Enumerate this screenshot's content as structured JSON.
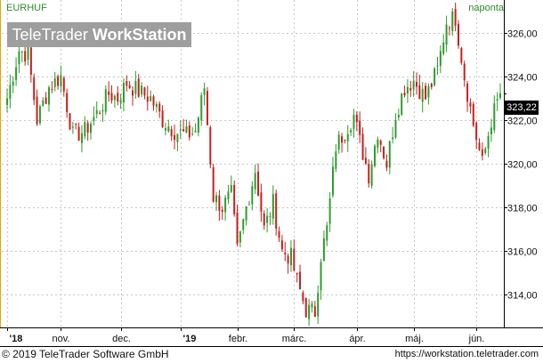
{
  "app": {
    "symbol": "EURHUF",
    "interval": "naponta",
    "watermark_prefix": "TeleTrader",
    "watermark_bold": "WorkStation",
    "footer_copyright": "© 2019 TeleTrader Software GmbH",
    "footer_url": "https://workstation.teletrader.com",
    "last_value_label": "323,22"
  },
  "colors": {
    "up": "#2e9c2e",
    "down": "#c81e1e",
    "grid": "#c8c8c8",
    "axis": "#000000",
    "watermark_bg": "#9e9e9e",
    "text_green": "#2e8b2e"
  },
  "chart_data": {
    "type": "candlestick",
    "title": "EURHUF",
    "interval": "naponta",
    "ylim": [
      312.5,
      327.5
    ],
    "y_ticks": [
      314,
      316,
      318,
      320,
      322,
      324,
      326
    ],
    "y_tick_labels": [
      "314,00",
      "316,00",
      "318,00",
      "320,00",
      "322,00",
      "324,00",
      "326,00"
    ],
    "x_ticks": [
      {
        "label": "'18",
        "index": 0
      },
      {
        "label": "nov.",
        "index": 18
      },
      {
        "label": "dec.",
        "index": 38
      },
      {
        "label": "'19",
        "index": 58
      },
      {
        "label": "febr.",
        "index": 77
      },
      {
        "label": "márc.",
        "index": 96
      },
      {
        "label": "ápr.",
        "index": 117
      },
      {
        "label": "máj.",
        "index": 136
      },
      {
        "label": "jún.",
        "index": 157
      }
    ],
    "grid": true,
    "last_value": 323.22,
    "close_path": [
      [
        0,
        323.0
      ],
      [
        4,
        325.2
      ],
      [
        7,
        325.0
      ],
      [
        10,
        322.0
      ],
      [
        14,
        323.5
      ],
      [
        18,
        324.0
      ],
      [
        22,
        321.3
      ],
      [
        26,
        321.5
      ],
      [
        30,
        322.3
      ],
      [
        34,
        323.2
      ],
      [
        37,
        323.0
      ],
      [
        40,
        323.7
      ],
      [
        44,
        323.3
      ],
      [
        48,
        323.0
      ],
      [
        52,
        322.0
      ],
      [
        56,
        321.5
      ],
      [
        60,
        321.3
      ],
      [
        63,
        321.5
      ],
      [
        66,
        323.5
      ],
      [
        69,
        318.5
      ],
      [
        72,
        318.0
      ],
      [
        75,
        318.6
      ],
      [
        77,
        316.0
      ],
      [
        80,
        318.0
      ],
      [
        83,
        319.7
      ],
      [
        86,
        317.0
      ],
      [
        89,
        318.2
      ],
      [
        92,
        316.0
      ],
      [
        95,
        315.7
      ],
      [
        97,
        314.6
      ],
      [
        100,
        313.3
      ],
      [
        103,
        313.2
      ],
      [
        105,
        315.8
      ],
      [
        107,
        317.0
      ],
      [
        110,
        320.8
      ],
      [
        113,
        321.5
      ],
      [
        116,
        322.2
      ],
      [
        118,
        321.0
      ],
      [
        121,
        319.5
      ],
      [
        124,
        321.5
      ],
      [
        127,
        320.0
      ],
      [
        130,
        322.3
      ],
      [
        133,
        323.5
      ],
      [
        136,
        323.8
      ],
      [
        140,
        323.0
      ],
      [
        144,
        324.3
      ],
      [
        147,
        326.5
      ],
      [
        150,
        326.7
      ],
      [
        153,
        324.0
      ],
      [
        156,
        321.8
      ],
      [
        159,
        320.0
      ],
      [
        162,
        322.0
      ],
      [
        165,
        323.22
      ]
    ],
    "n_bars": 166
  }
}
